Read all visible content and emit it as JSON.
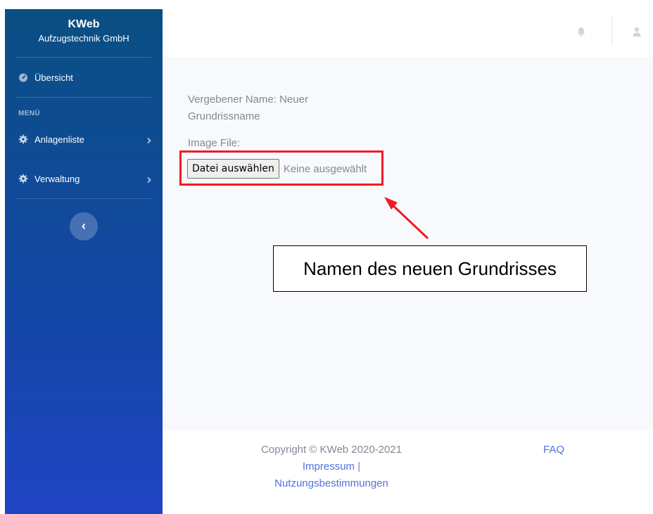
{
  "sidebar": {
    "brand_title": "KWeb",
    "brand_subtitle": "Aufzugstechnik GmbH",
    "overview_label": "Übersicht",
    "section_menu": "MENÜ",
    "items": [
      {
        "label": "Anlagenliste",
        "icon": "gear-icon"
      },
      {
        "label": "Verwaltung",
        "icon": "gear-icon"
      }
    ],
    "toggle_icon": "chevron-left-icon"
  },
  "topbar": {
    "notifications_icon": "bell-icon",
    "user_icon": "user-icon"
  },
  "form": {
    "name_text": "Vergebener Name: Neuer Grundrissname",
    "image_label": "Image File:",
    "file_button_label": "Datei auswählen",
    "file_status": "Keine ausgewählt"
  },
  "annotation": {
    "callout_text": "Namen des neuen Grundrisses",
    "highlight_color": "#ee1c24"
  },
  "footer": {
    "copyright": "Copyright © KWeb 2020-2021",
    "impressum": "Impressum",
    "separator": "|",
    "terms": "Nutzungsbestimmungen",
    "faq": "FAQ"
  },
  "colors": {
    "sidebar_top": "#0a4f83",
    "sidebar_bottom": "#2044c4",
    "link": "#4e73df",
    "muted_text": "#858796"
  }
}
